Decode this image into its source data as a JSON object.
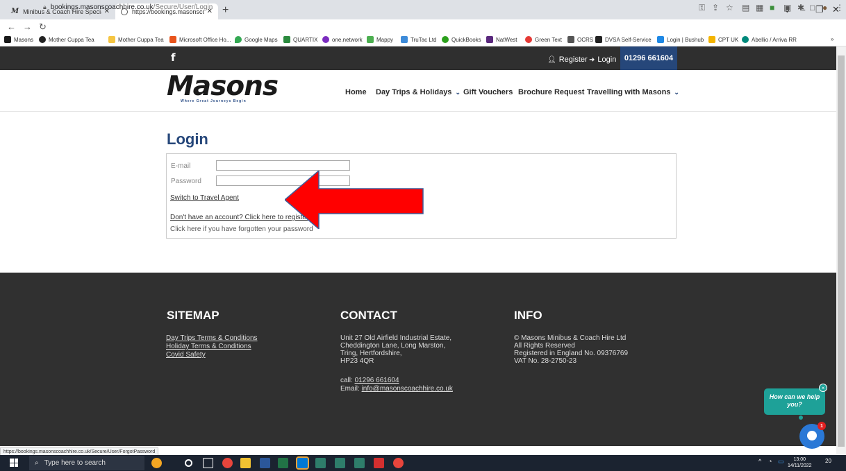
{
  "browser": {
    "tabs": [
      {
        "label": "Minibus & Coach Hire Specialists",
        "favicon": "M"
      },
      {
        "label": "https://bookings.masonscoachhi",
        "favicon": "globe-icon"
      }
    ],
    "new_tab": "+",
    "url_domain": "bookings.masonscoachhire.co.uk",
    "url_path": "/Secure/User/Login",
    "bookmarks": [
      {
        "label": "Masons",
        "color": "#1a1a1a"
      },
      {
        "label": "Mother Cuppa Tea",
        "color": "#222222"
      },
      {
        "label": "Mother Cuppa Tea",
        "color": "#f5c542"
      },
      {
        "label": "Microsoft Office Ho...",
        "color": "#e8541c"
      },
      {
        "label": "Google Maps",
        "color": "#34a853"
      },
      {
        "label": "QUARTIX",
        "color": "#2b8a3e"
      },
      {
        "label": "one.network",
        "color": "#7b2cbf"
      },
      {
        "label": "Mappy",
        "color": "#4caf50"
      },
      {
        "label": "TruTac Ltd",
        "color": "#3d8bd9"
      },
      {
        "label": "QuickBooks",
        "color": "#2ca01c"
      },
      {
        "label": "NatWest",
        "color": "#5a287d"
      },
      {
        "label": "Green Text",
        "color": "#e53935"
      },
      {
        "label": "OCRS",
        "color": "#333333"
      },
      {
        "label": "DVSA Self-Service",
        "color": "#222222"
      },
      {
        "label": "Login | Bushub",
        "color": "#1e88e5"
      },
      {
        "label": "CPT UK",
        "color": "#f4b400"
      },
      {
        "label": "Abellio / Arriva RR",
        "color": "#00897b"
      }
    ],
    "status_url": "https://bookings.masonscoachhire.co.uk/Secure/User/ForgotPassword"
  },
  "topbar": {
    "register": "Register",
    "login": "Login",
    "phone": "01296 661604"
  },
  "header": {
    "logo": "Masons",
    "tagline": "Where Great Journeys Begin",
    "nav": [
      "Home",
      "Day Trips & Holidays",
      "Gift Vouchers",
      "Brochure Request",
      "Travelling with Masons"
    ]
  },
  "login": {
    "title": "Login",
    "email_label": "E-mail",
    "email_value": "",
    "password_label": "Password",
    "password_value": "",
    "travel_agent_link": "Switch to Travel Agent",
    "register_link": "Don't have an account? Click here to register",
    "forgot_text": "Click here if you have forgotten your password"
  },
  "footer": {
    "sitemap_title": "SITEMAP",
    "sitemap_links": [
      "Day Trips Terms & Conditions",
      "Holiday Terms & Conditions",
      "Covid Safety"
    ],
    "contact_title": "CONTACT",
    "address": [
      "Unit 27 Old Airfield Industrial Estate,",
      "Cheddington Lane, Long Marston,",
      "Tring, Hertfordshire,",
      "HP23 4QR"
    ],
    "call_prefix": "call: ",
    "phone": "01296 661604",
    "email_prefix": "Email: ",
    "email": "info@masonscoachhire.co.uk",
    "info_title": "INFO",
    "info_lines": [
      "© Masons Minibus & Coach Hire Ltd",
      "All Rights Reserved",
      "Registered in England No. 09376769",
      "VAT No. 28-2750-23"
    ]
  },
  "chat": {
    "bubble_line1": "How can we help",
    "bubble_line2": "you?",
    "close": "×",
    "badge": "1"
  },
  "taskbar": {
    "search_placeholder": "Type here to search",
    "time": "13:00",
    "date": "14/11/2022",
    "notifications": "20"
  },
  "colors": {
    "brand_blue": "#26477a",
    "arrow_red": "#ff0000",
    "footer_bg": "#303030",
    "chat_teal": "#1ea198"
  }
}
